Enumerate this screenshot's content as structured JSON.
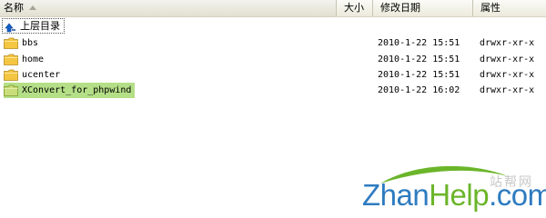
{
  "header": {
    "col_name": "名称",
    "col_size": "大小",
    "col_modified": "修改日期",
    "col_attr": "属性"
  },
  "up_dir": {
    "label": "上层目录",
    "icon": "up-arrow-icon"
  },
  "files": [
    {
      "name": "bbs",
      "date": "2010-1-22 15:51",
      "perm": "drwxr-xr-x",
      "icon": "folder-icon",
      "selected": false
    },
    {
      "name": "home",
      "date": "2010-1-22 15:51",
      "perm": "drwxr-xr-x",
      "icon": "folder-icon",
      "selected": false
    },
    {
      "name": "ucenter",
      "date": "2010-1-22 15:51",
      "perm": "drwxr-xr-x",
      "icon": "folder-icon",
      "selected": false
    },
    {
      "name": "XConvert_for_phpwind",
      "date": "2010-1-22 16:02",
      "perm": "drwxr-xr-x",
      "icon": "folder-icon",
      "selected": true
    }
  ],
  "watermark": {
    "cn_text": "站帮网",
    "logo_zhan": "Zhan",
    "logo_help": "Help",
    "logo_com": ".com"
  },
  "colors": {
    "selection": "#b5df87",
    "folder": "#f5c642",
    "logo_blue": "#2e7bc0",
    "logo_green": "#6bb52a"
  }
}
